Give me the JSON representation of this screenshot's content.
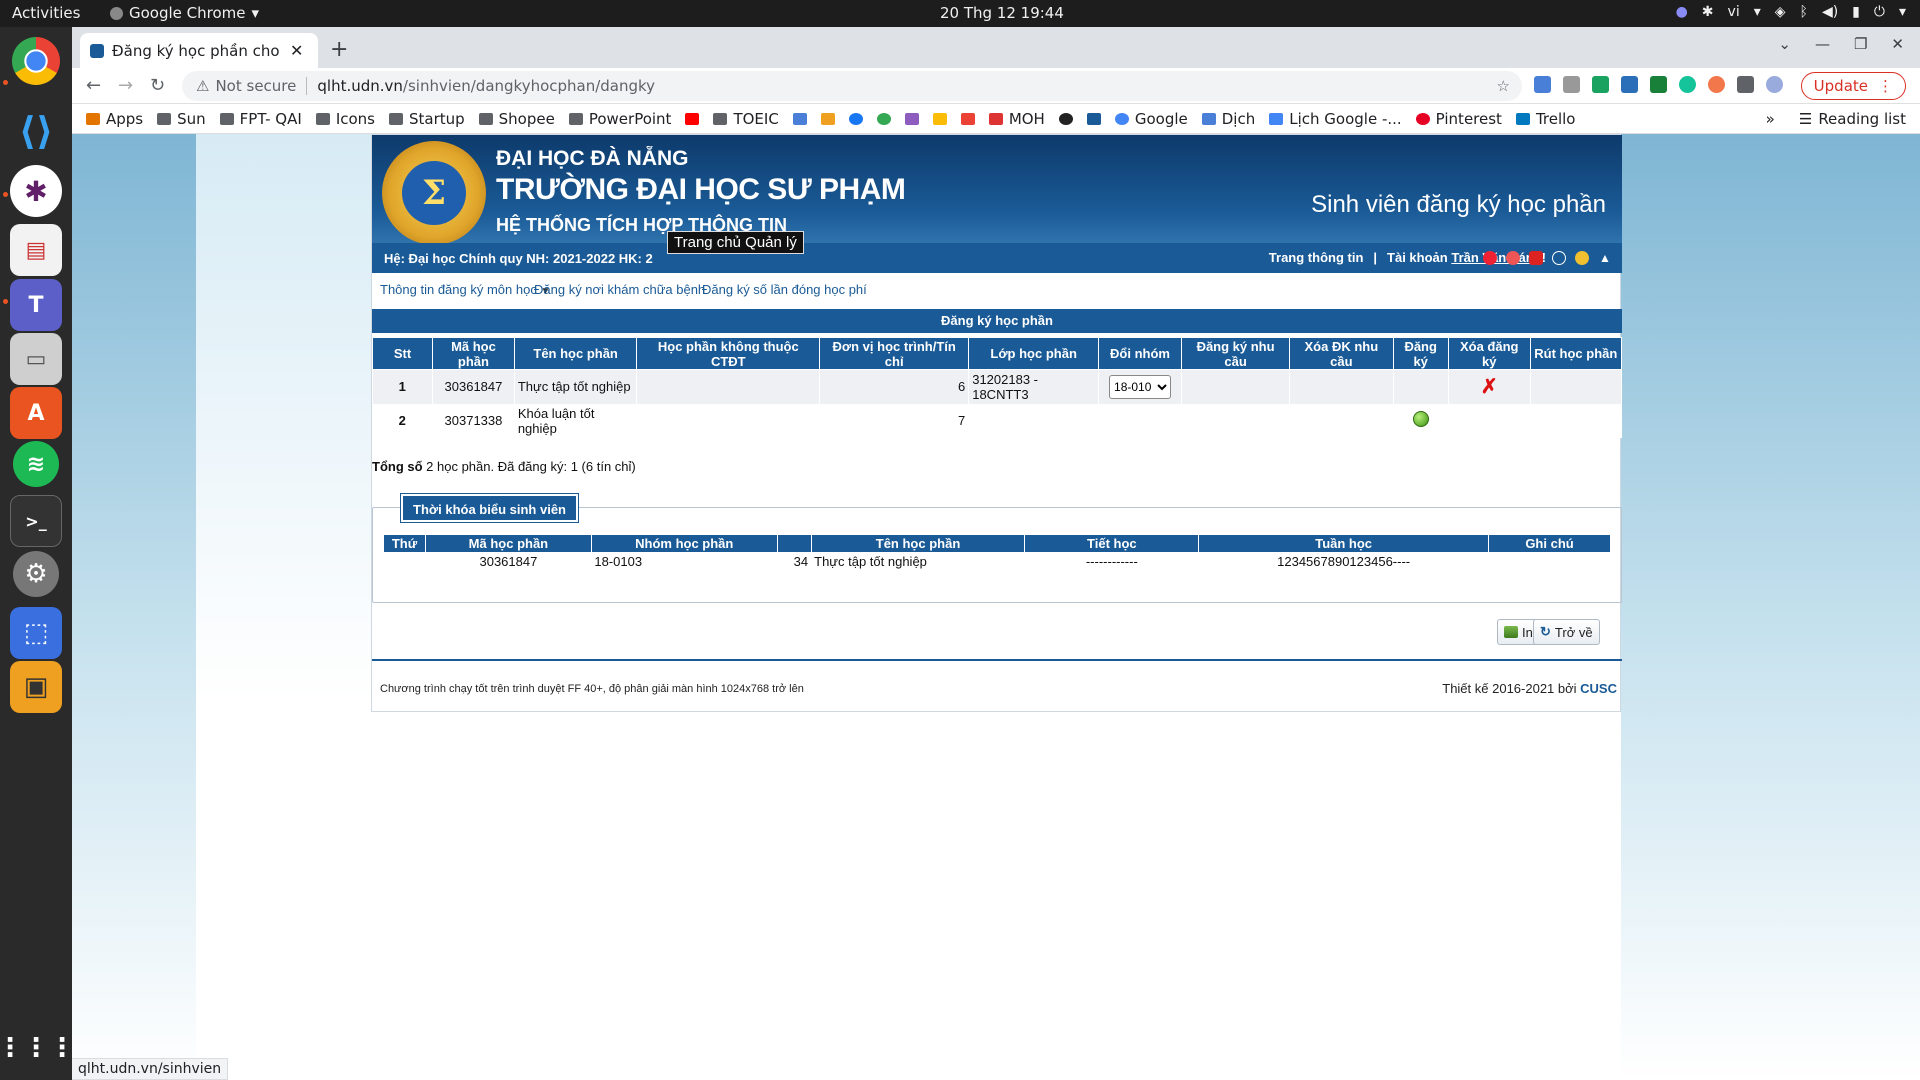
{
  "os": {
    "activities": "Activities",
    "app_name": "Google Chrome",
    "clock": "20 Thg 12  19:44",
    "lang": "vi"
  },
  "browser": {
    "tab_title": "Đăng ký học phần cho sin",
    "not_secure": "Not secure",
    "url_host": "qlht.udn.vn",
    "url_path": "/sinhvien/dangkyhocphan/dangky",
    "update_label": "Update",
    "bookmarks": [
      "Apps",
      "Sun",
      "FPT- QAI",
      "Icons",
      "Startup",
      "Shopee",
      "PowerPoint",
      "TOEIC",
      "MOH",
      "Google",
      "Dịch",
      "Lịch Google -...",
      "Pinterest",
      "Trello"
    ],
    "reading_list": "Reading list",
    "status_url": "qlht.udn.vn/sinhvien"
  },
  "header": {
    "uni_line1": "ĐẠI HỌC ĐÀ NẴNG",
    "uni_line2": "TRƯỜNG ĐẠI HỌC SƯ PHẠM",
    "uni_line3": "HỆ THỐNG TÍCH HỢP THÔNG TIN",
    "page_title": "Sinh viên đăng ký học phần",
    "tooltip": "Trang chủ Quản lý"
  },
  "infobar": {
    "program": "Hệ: Đại học Chính quy  NH: 2021-2022  HK: 2",
    "info_link": "Trang thông tin",
    "separator": "|",
    "account_label": "Tài khoản",
    "account_name": "Trần Văn Sáng",
    "account_suffix": "!"
  },
  "menu": {
    "item1": "Thông tin đăng ký môn học",
    "item2": "Đăng ký nơi khám chữa bệnh",
    "item3": "Đăng ký số lần đóng học phí"
  },
  "registration": {
    "section_title": "Đăng ký học phần",
    "columns": [
      "Stt",
      "Mã học phần",
      "Tên học phần",
      "Học phần không thuộc CTĐT",
      "Đơn vị học trình/Tín chỉ",
      "Lớp học phần",
      "Đổi nhóm",
      "Đăng ký nhu cầu",
      "Xóa ĐK nhu cầu",
      "Đăng ký",
      "Xóa đăng ký",
      "Rút học phần"
    ],
    "rows": [
      {
        "stt": "1",
        "code": "30361847",
        "name": "Thực tập tốt nghiệp",
        "credits": "6",
        "class": "31202183 - 18CNTT3",
        "group": "18-010"
      },
      {
        "stt": "2",
        "code": "30371338",
        "name": "Khóa luận tốt nghiệp",
        "credits": "7",
        "class": "",
        "group": ""
      }
    ],
    "total_label": "Tổng số",
    "total_text": " 2 học phần. Đã đăng ký: 1 (6 tín chỉ)"
  },
  "schedule": {
    "title": "Thời khóa biểu sinh viên",
    "columns": [
      "Thứ",
      "Mã học phần",
      "Nhóm học phần",
      "",
      "Tên học phần",
      "Tiết học",
      "Tuần học",
      "Ghi chú"
    ],
    "row": {
      "day": "",
      "code": "30361847",
      "group": "18-0103",
      "num": "34",
      "name": "Thực tập tốt nghiệp",
      "period": "------------",
      "weeks": "1234567890123456----",
      "note": ""
    }
  },
  "actions": {
    "print": "In",
    "back": "Trở về"
  },
  "footer": {
    "note": "Chương trình chạy tốt trên trình duyệt FF 40+, độ phân giải màn hình 1024x768 trở lên",
    "design": "Thiết kế 2016-2021 bởi",
    "company": "CUSC"
  },
  "colors": {
    "primary": "#1a5a96",
    "header_dark": "#0d3a6b",
    "delete_red": "#dd1111",
    "update_red": "#d93025"
  }
}
